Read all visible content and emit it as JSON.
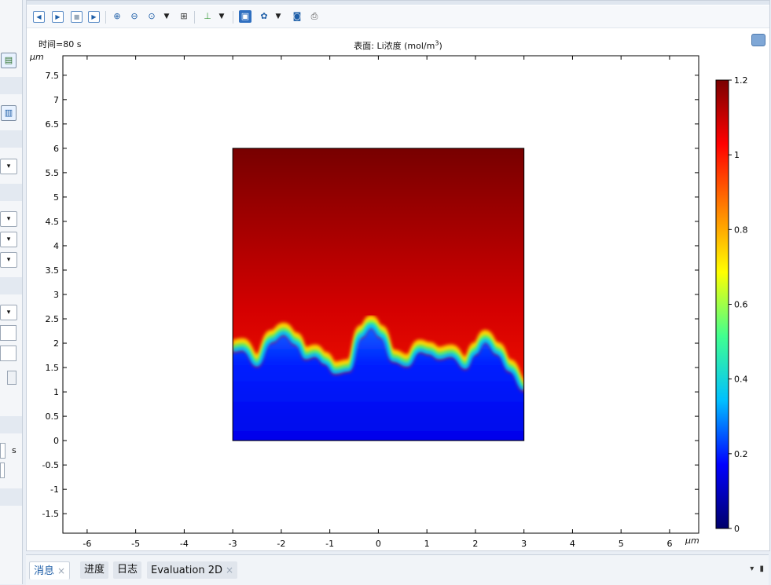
{
  "left_panel": {
    "unit_label": "s"
  },
  "toolbar": {
    "icons": [
      "first-frame-icon",
      "play-icon",
      "stop-icon",
      "last-frame-icon",
      "zoom-in-icon",
      "zoom-out-icon",
      "zoom-box-icon",
      "zoom-extents-icon",
      "axis-orientation-icon",
      "scene-light-icon",
      "transparency-icon",
      "camera-icon",
      "print-icon"
    ]
  },
  "plot": {
    "time_label": "时间=80 s",
    "title_prefix": "表面: Li浓度 (mol/m",
    "title_sup": "3",
    "title_suffix": ")",
    "x_unit": "μm",
    "y_unit": "μm"
  },
  "chart_data": {
    "type": "heatmap",
    "title": "表面: Li浓度 (mol/m3)",
    "time": "80 s",
    "xlabel": "μm",
    "ylabel": "μm",
    "xlim": [
      -6.5,
      6.6
    ],
    "ylim": [
      -1.9,
      7.9
    ],
    "x_ticks": [
      -6,
      -5,
      -4,
      -3,
      -2,
      -1,
      0,
      1,
      2,
      3,
      4,
      5,
      6
    ],
    "y_ticks": [
      -1.5,
      -1,
      -0.5,
      0,
      0.5,
      1,
      1.5,
      2,
      2.5,
      3,
      3.5,
      4,
      4.5,
      5,
      5.5,
      6,
      6.5,
      7,
      7.5
    ],
    "domain_box": {
      "x": [
        -3,
        3
      ],
      "y": [
        0,
        6
      ]
    },
    "interface_front": {
      "x": [
        -3,
        -2.8,
        -2.5,
        -2.2,
        -1.95,
        -1.7,
        -1.5,
        -1.3,
        -1.1,
        -0.9,
        -0.6,
        -0.35,
        -0.15,
        0.05,
        0.3,
        0.6,
        0.85,
        1.05,
        1.25,
        1.5,
        1.8,
        2.0,
        2.2,
        2.45,
        2.7,
        3.0
      ],
      "y": [
        2.0,
        2.03,
        1.7,
        2.2,
        2.35,
        2.15,
        1.85,
        1.9,
        1.75,
        1.55,
        1.6,
        2.3,
        2.5,
        2.3,
        1.8,
        1.7,
        2.0,
        1.95,
        1.85,
        1.9,
        1.65,
        1.95,
        2.2,
        1.95,
        1.6,
        1.2
      ]
    },
    "colorbar": {
      "min": 0,
      "max": 1.2,
      "ticks": [
        0,
        0.2,
        0.4,
        0.6,
        0.8,
        1,
        1.2
      ],
      "colormap": "rainbow",
      "stops": [
        "#00006a",
        "#0000ff",
        "#00c0ff",
        "#40ff90",
        "#ffff00",
        "#ff8000",
        "#ff0000",
        "#7a0000"
      ]
    },
    "grid": false
  },
  "tabs": [
    {
      "label": "消息",
      "closable": true,
      "active": true
    },
    {
      "label": "进度",
      "closable": false,
      "active": false
    },
    {
      "label": "日志",
      "closable": false,
      "active": false
    },
    {
      "label": "Evaluation 2D",
      "closable": true,
      "active": false
    }
  ],
  "icons": {
    "close": "×",
    "panel_menu": "▾",
    "pin": "▮"
  }
}
